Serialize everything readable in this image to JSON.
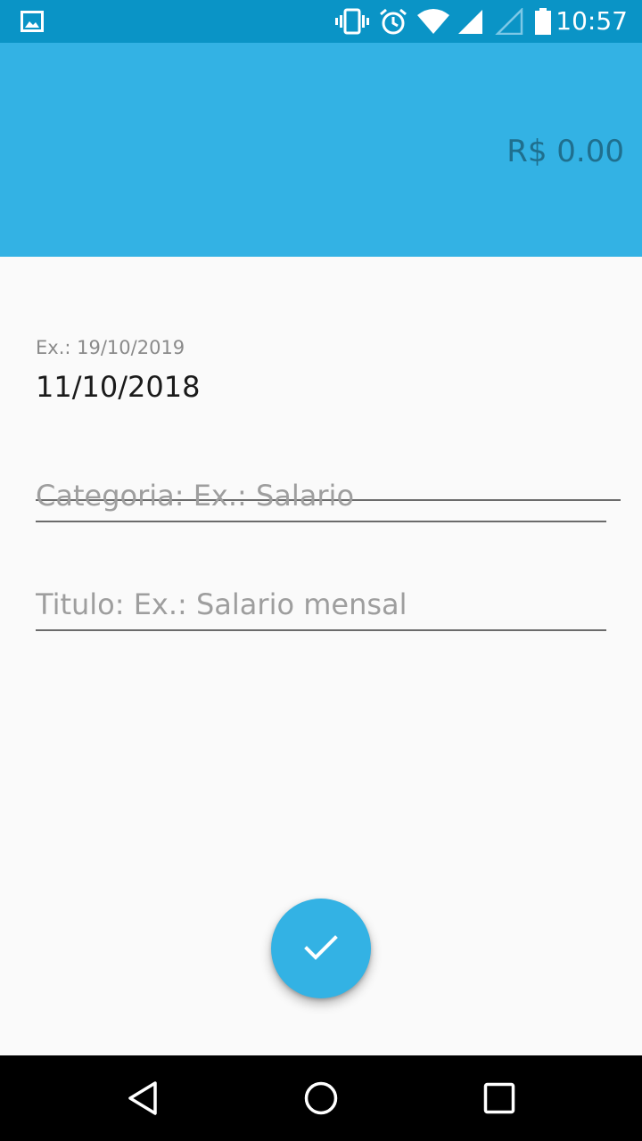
{
  "status_bar": {
    "time": "10:57",
    "icons": [
      "image-icon",
      "vibrate-icon",
      "alarm-icon",
      "wifi-icon",
      "signal-icon",
      "signal-outline-icon",
      "battery-icon"
    ]
  },
  "header": {
    "balance": "R$ 0.00"
  },
  "form": {
    "date": {
      "hint": "Ex.: 19/10/2019",
      "value": "11/10/2018"
    },
    "categoria": {
      "placeholder": "Categoria: Ex.: Salario",
      "value": ""
    },
    "titulo": {
      "placeholder": "Titulo: Ex.: Salario mensal",
      "value": ""
    }
  },
  "fab": {
    "icon": "check-icon"
  },
  "nav_bar": {
    "buttons": [
      "back-icon",
      "home-icon",
      "recents-icon"
    ]
  },
  "colors": {
    "status_bar": "#0a94c6",
    "header": "#33b2e4",
    "balance_text": "#1f6f8e",
    "background": "#fafafa",
    "fab": "#33b2e4"
  }
}
